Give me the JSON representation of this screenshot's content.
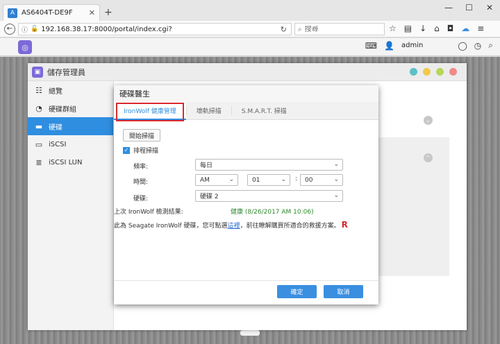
{
  "browser": {
    "tab_title": "AS6404T-DE9F",
    "tab_close": "✕",
    "new_tab": "+",
    "min": "—",
    "max": "☐",
    "close": "✕",
    "url": "192.168.38.17:8000/portal/index.cgi?",
    "search_placeholder": "搜尋"
  },
  "nas": {
    "user": "admin"
  },
  "app": {
    "title": "儲存管理員",
    "sidebar": [
      {
        "label": "總覽",
        "icon": "list-icon"
      },
      {
        "label": "硬碟群組",
        "icon": "pie-icon"
      },
      {
        "label": "硬碟",
        "icon": "drive-icon"
      },
      {
        "label": "iSCSI",
        "icon": "server-icon"
      },
      {
        "label": "iSCSI LUN",
        "icon": "database-icon"
      }
    ],
    "active_index": 2
  },
  "dialog": {
    "title": "硬碟醫生",
    "tabs": [
      "IronWolf 健康管理",
      "壞軌掃描",
      "S.M.A.R.T. 掃描"
    ],
    "active_tab": 0,
    "scan_button": "開始掃描",
    "schedule_label": "排程掃描",
    "schedule_checked": true,
    "frequency_label": "頻率:",
    "frequency_value": "每日",
    "time_label": "時間:",
    "ampm_value": "AM",
    "hour_value": "01",
    "time_colon": ":",
    "minute_value": "00",
    "disk_label": "硬碟:",
    "disk_value": "硬碟 2",
    "result_label": "上次 IronWolf 檢測結果:",
    "result_value": "健康 (8/26/2017 AM 10:06)",
    "note_prefix": "此為 Seagate IronWolf 硬碟，您可點選",
    "note_link": "這裡",
    "note_suffix": "，前往瞭解購買所適合的救援方案。",
    "r_logo": "R",
    "ok_button": "確定",
    "cancel_button": "取消"
  },
  "colors": {
    "accent": "#2f8ee0",
    "highlight": "#d9292e",
    "ok_green": "#2d8a2d",
    "dot_teal": "#5bc0c7",
    "dot_yellow": "#f2c94c",
    "dot_green": "#b6d65a",
    "dot_pink": "#f08a8a"
  }
}
